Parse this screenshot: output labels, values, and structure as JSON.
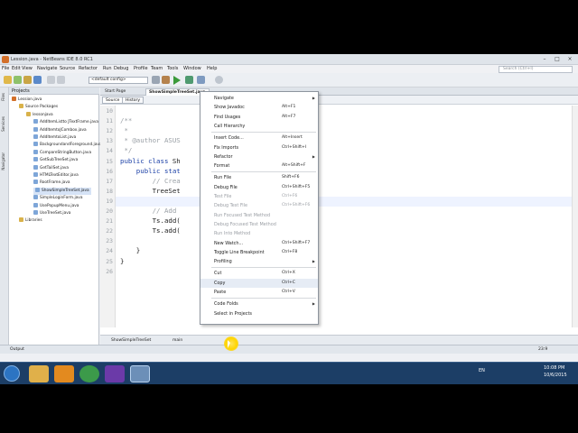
{
  "window": {
    "title": "Lession.java - NetBeans IDE 8.0 RC1"
  },
  "menubar": {
    "items": [
      "File",
      "Edit",
      "View",
      "Navigate",
      "Source",
      "Refactor",
      "Run",
      "Debug",
      "Profile",
      "Team",
      "Tools",
      "Window",
      "Help"
    ],
    "search_placeholder": "Search (Ctrl+I)"
  },
  "toolbar": {
    "config": "<default config>"
  },
  "left_strip": {
    "tabs": [
      "Files",
      "Services",
      "Navigator"
    ]
  },
  "projects_panel": {
    "tab": "Projects",
    "tree": [
      {
        "label": "Lession.java",
        "indent": 0,
        "kind": "project"
      },
      {
        "label": "Source Packages",
        "indent": 1,
        "kind": "folder"
      },
      {
        "label": "lessonjava",
        "indent": 2,
        "kind": "package"
      },
      {
        "label": "AddItemListto JTextFrame.java",
        "indent": 3,
        "kind": "file"
      },
      {
        "label": "AddItemtoJCombox.java",
        "indent": 3,
        "kind": "file"
      },
      {
        "label": "AddItemtoList.java",
        "indent": 3,
        "kind": "file"
      },
      {
        "label": "BackgroundandForeground.java",
        "indent": 3,
        "kind": "file"
      },
      {
        "label": "CompareStringButton.java",
        "indent": 3,
        "kind": "file"
      },
      {
        "label": "GetSubTreeSet.java",
        "indent": 3,
        "kind": "file"
      },
      {
        "label": "GetTailSet.java",
        "indent": 3,
        "kind": "file"
      },
      {
        "label": "HTMLTextEditor.java",
        "indent": 3,
        "kind": "file"
      },
      {
        "label": "RootFrame.java",
        "indent": 3,
        "kind": "file"
      },
      {
        "label": "ShowSimpleTreeSet.java",
        "indent": 3,
        "kind": "file",
        "selected": true
      },
      {
        "label": "SimpleLoginForm.java",
        "indent": 3,
        "kind": "file"
      },
      {
        "label": "UsePopupMenu.java",
        "indent": 3,
        "kind": "file"
      },
      {
        "label": "UseTreeSet.java",
        "indent": 3,
        "kind": "file"
      },
      {
        "label": "Libraries",
        "indent": 1,
        "kind": "folder"
      }
    ]
  },
  "editor": {
    "tabs": [
      "Start Page",
      "ShowSimpleTreeSet.java"
    ],
    "source_buttons": [
      "Source",
      "History"
    ],
    "lines": [
      {
        "no": "10",
        "segments": [
          {
            "t": "",
            "c": "dark"
          }
        ]
      },
      {
        "no": "11",
        "segments": [
          {
            "t": "/**",
            "c": "gray"
          }
        ]
      },
      {
        "no": "12",
        "segments": [
          {
            "t": " *",
            "c": "gray"
          }
        ]
      },
      {
        "no": "13",
        "segments": [
          {
            "t": " * @author ASUS",
            "c": "gray"
          }
        ]
      },
      {
        "no": "14",
        "segments": [
          {
            "t": " */",
            "c": "gray"
          }
        ]
      },
      {
        "no": "15",
        "segments": [
          {
            "t": "public class ",
            "c": "blue"
          },
          {
            "t": "Sh",
            "c": "dark"
          }
        ]
      },
      {
        "no": "16",
        "segments": [
          {
            "t": "    public stat",
            "c": "blue"
          },
          {
            "t": "                           s) {",
            "c": "dark"
          }
        ]
      },
      {
        "no": "17",
        "segments": [
          {
            "t": "        // Crea",
            "c": "gray"
          }
        ]
      },
      {
        "no": "18",
        "segments": [
          {
            "t": "        TreeSet",
            "c": "dark"
          }
        ]
      },
      {
        "no": "19",
        "segments": [
          {
            "t": "",
            "c": "dark"
          }
        ]
      },
      {
        "no": "20",
        "segments": [
          {
            "t": "        // Add ",
            "c": "gray"
          }
        ]
      },
      {
        "no": "21",
        "segments": [
          {
            "t": "        Ts.add(",
            "c": "dark"
          }
        ]
      },
      {
        "no": "22",
        "segments": [
          {
            "t": "        Ts.add(",
            "c": "dark"
          }
        ]
      },
      {
        "no": "23",
        "segments": [
          {
            "t": "",
            "c": "dark"
          }
        ]
      },
      {
        "no": "24",
        "segments": [
          {
            "t": "    }",
            "c": "dark"
          }
        ]
      },
      {
        "no": "25",
        "segments": [
          {
            "t": "}",
            "c": "dark"
          }
        ]
      },
      {
        "no": "26",
        "segments": [
          {
            "t": "",
            "c": "dark"
          }
        ]
      }
    ],
    "breadcrumbs": [
      "ShowSimpleTreeSet",
      "main"
    ]
  },
  "context_menu": {
    "items": [
      {
        "label": "Navigate",
        "shortcut": "",
        "submenu": true
      },
      {
        "label": "Show Javadoc",
        "shortcut": "Alt+F1"
      },
      {
        "label": "Find Usages",
        "shortcut": "Alt+F7"
      },
      {
        "label": "Call Hierarchy",
        "shortcut": ""
      },
      {
        "sep": true
      },
      {
        "label": "Insert Code...",
        "shortcut": "Alt+Insert"
      },
      {
        "label": "Fix Imports",
        "shortcut": "Ctrl+Shift+I"
      },
      {
        "label": "Refactor",
        "shortcut": "",
        "submenu": true
      },
      {
        "label": "Format",
        "shortcut": "Alt+Shift+F"
      },
      {
        "sep": true
      },
      {
        "label": "Run File",
        "shortcut": "Shift+F6"
      },
      {
        "label": "Debug File",
        "shortcut": "Ctrl+Shift+F5"
      },
      {
        "label": "Test File",
        "shortcut": "Ctrl+F6",
        "disabled": true
      },
      {
        "label": "Debug Test File",
        "shortcut": "Ctrl+Shift+F6",
        "disabled": true
      },
      {
        "label": "Run Focused Test Method",
        "shortcut": "",
        "disabled": true
      },
      {
        "label": "Debug Focused Test Method",
        "shortcut": "",
        "disabled": true
      },
      {
        "label": "Run Into Method",
        "shortcut": "",
        "disabled": true
      },
      {
        "label": "New Watch...",
        "shortcut": "Ctrl+Shift+F7"
      },
      {
        "label": "Toggle Line Breakpoint",
        "shortcut": "Ctrl+F8"
      },
      {
        "label": "Profiling",
        "shortcut": "",
        "submenu": true
      },
      {
        "sep": true
      },
      {
        "label": "Cut",
        "shortcut": "Ctrl+X"
      },
      {
        "label": "Copy",
        "shortcut": "Ctrl+C",
        "highlight": true
      },
      {
        "label": "Paste",
        "shortcut": "Ctrl+V"
      },
      {
        "sep": true
      },
      {
        "label": "Code Folds",
        "shortcut": "",
        "submenu": true
      },
      {
        "label": "Select in Projects",
        "shortcut": ""
      }
    ]
  },
  "output": {
    "label": "Output",
    "position": "23:9"
  },
  "taskbar": {
    "lang": "EN",
    "time": "10:08 PM",
    "date": "10/6/2015"
  },
  "colors": {
    "accent": "#1a3fa6",
    "taskbar": "#1c3e66",
    "highlight": "#ffd400"
  }
}
